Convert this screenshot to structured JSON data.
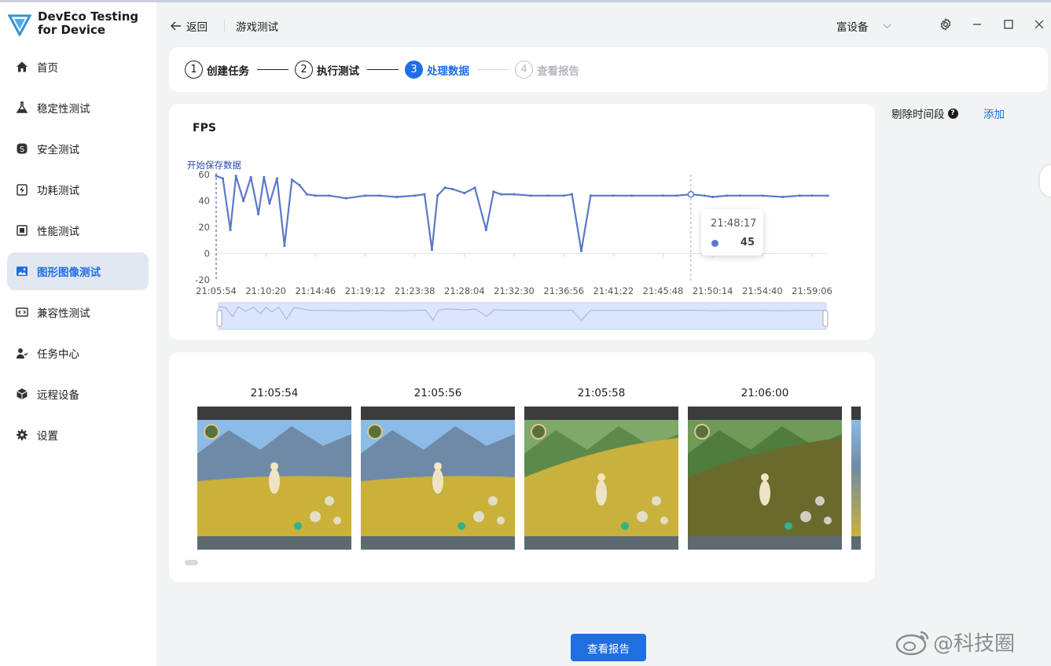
{
  "app": {
    "brand_line1": "DevEco Testing",
    "brand_line2": "for Device"
  },
  "sidebar": {
    "items": [
      {
        "label": "首页",
        "icon": "home-icon"
      },
      {
        "label": "稳定性测试",
        "icon": "flask-icon"
      },
      {
        "label": "安全测试",
        "icon": "shield-icon"
      },
      {
        "label": "功耗测试",
        "icon": "battery-icon"
      },
      {
        "label": "性能测试",
        "icon": "chip-icon"
      },
      {
        "label": "图形图像测试",
        "icon": "image-icon",
        "active": true
      },
      {
        "label": "兼容性测试",
        "icon": "code-icon"
      },
      {
        "label": "任务中心",
        "icon": "user-task-icon"
      },
      {
        "label": "远程设备",
        "icon": "cube-icon"
      },
      {
        "label": "设置",
        "icon": "gear-icon"
      }
    ]
  },
  "header": {
    "back_label": "返回",
    "breadcrumb": "游戏测试",
    "device_label": "富设备"
  },
  "stepper": {
    "steps": [
      {
        "num": "1",
        "label": "创建任务",
        "state": "done"
      },
      {
        "num": "2",
        "label": "执行测试",
        "state": "done"
      },
      {
        "num": "3",
        "label": "处理数据",
        "state": "active"
      },
      {
        "num": "4",
        "label": "查看报告",
        "state": "pending"
      }
    ]
  },
  "chart_data": {
    "type": "line",
    "title": "FPS",
    "annotation": "开始保存数据",
    "ylim": [
      -20,
      60
    ],
    "yticks": [
      60,
      40,
      20,
      0,
      -20
    ],
    "x_ticks": [
      "21:05:54",
      "21:10:20",
      "21:14:46",
      "21:19:12",
      "21:23:38",
      "21:28:04",
      "21:32:30",
      "21:36:56",
      "21:41:22",
      "21:45:48",
      "21:50:14",
      "21:54:40",
      "21:59:06"
    ],
    "series": [
      {
        "color": "#5b78c8",
        "x": [
          "21:05:54",
          "21:06:30",
          "21:07:10",
          "21:07:40",
          "21:08:20",
          "21:09:00",
          "21:09:40",
          "21:10:10",
          "21:10:40",
          "21:11:20",
          "21:12:00",
          "21:12:40",
          "21:13:20",
          "21:14:00",
          "21:14:46",
          "21:16:00",
          "21:17:30",
          "21:19:12",
          "21:20:30",
          "21:22:00",
          "21:23:38",
          "21:24:30",
          "21:25:10",
          "21:25:40",
          "21:26:20",
          "21:27:00",
          "21:28:04",
          "21:29:00",
          "21:30:00",
          "21:30:40",
          "21:31:20",
          "21:32:30",
          "21:34:00",
          "21:35:30",
          "21:36:56",
          "21:37:40",
          "21:38:30",
          "21:39:20",
          "21:41:22",
          "21:43:00",
          "21:45:48",
          "21:47:00",
          "21:48:17",
          "21:49:30",
          "21:50:14",
          "21:51:30",
          "21:52:40",
          "21:54:40",
          "21:56:30",
          "21:58:00",
          "21:59:06",
          "22:00:30"
        ],
        "y": [
          59,
          57,
          18,
          59,
          40,
          58,
          30,
          58,
          38,
          57,
          6,
          56,
          52,
          45,
          44,
          44,
          42,
          44,
          44,
          43,
          44,
          45,
          3,
          44,
          50,
          49,
          46,
          50,
          18,
          47,
          45,
          45,
          44,
          44,
          44,
          45,
          2,
          44,
          44,
          44,
          44,
          44,
          45,
          44,
          43,
          44,
          44,
          44,
          43,
          44,
          44,
          44
        ]
      }
    ],
    "tooltip": {
      "time": "21:48:17",
      "value": "45"
    }
  },
  "right_panel": {
    "exclude_label": "剔除时间段",
    "help": "?",
    "add_label": "添加"
  },
  "screenshots": {
    "items": [
      {
        "time": "21:05:54"
      },
      {
        "time": "21:05:56"
      },
      {
        "time": "21:05:58"
      },
      {
        "time": "21:06:00"
      }
    ]
  },
  "report_button": "查看报告",
  "watermark": "@科技圈",
  "colors": {
    "accent": "#1f6fe3",
    "series": "#5b78c8",
    "sidebar_active_bg": "#e1e7f0"
  }
}
